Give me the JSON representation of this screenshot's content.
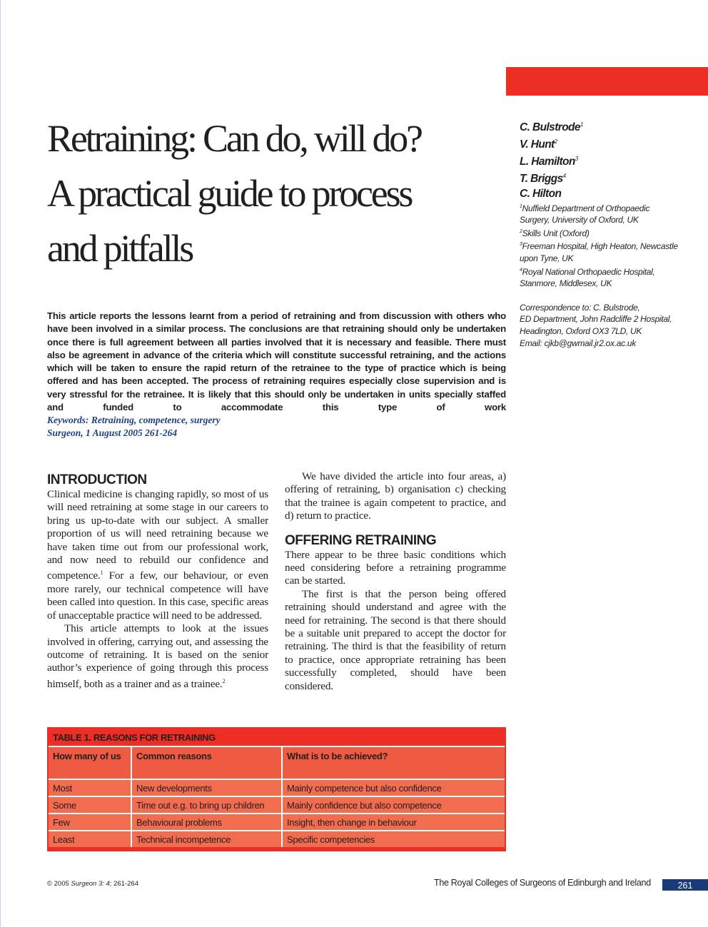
{
  "article": {
    "title_lines": [
      "Retraining: Can do, will do?",
      "A practical guide to process",
      "and pitfalls"
    ],
    "authors": [
      {
        "name": "C. Bulstrode",
        "sup": "1"
      },
      {
        "name": "V. Hunt",
        "sup": "2"
      },
      {
        "name": "L. Hamilton",
        "sup": "3"
      },
      {
        "name": "T. Briggs",
        "sup": "4"
      },
      {
        "name": "C. Hilton",
        "sup": ""
      }
    ],
    "affiliations": [
      {
        "sup": "1",
        "lines": [
          "Nuffield Department of Orthopaedic",
          "Surgery, University of Oxford, UK"
        ]
      },
      {
        "sup": "2",
        "lines": [
          "Skills Unit (Oxford)"
        ]
      },
      {
        "sup": "3",
        "lines": [
          "Freeman Hospital, High Heaton, Newcastle",
          "upon Tyne, UK"
        ]
      },
      {
        "sup": "4",
        "lines": [
          "Royal National Orthopaedic Hospital,",
          "Stanmore, Middlesex, UK"
        ]
      }
    ],
    "correspondence": [
      "Correspondence to: C. Bulstrode,",
      "ED Department, John Radcliffe 2 Hospital,",
      "Headington, Oxford OX3 7LD, UK",
      "Email: cjkb@gwmail.jr2.ox.ac.uk"
    ],
    "abstract": "This article reports the lessons learnt from a period of retraining and from discussion with others who have been involved in a similar process. The conclusions are that retraining should only be undertaken once there is full agreement between all parties involved that it is necessary and feasible. There must also be agreement in advance of the criteria which will constitute successful retraining, and the actions which will be taken to ensure the rapid return of the retrainee to the type of practice which is being offered and has been accepted. The process of retraining requires especially close supervision and is very stressful for the retrainee. It is likely that this should only be undertaken in units specially staffed and funded to accommodate this type of work",
    "keywords": "Keywords: Retraining, competence, surgery",
    "citation": "Surgeon, 1 August 2005 261-264"
  },
  "body": {
    "introduction": {
      "heading": "INTRODUCTION",
      "p1_a": "Clinical medicine is changing rapidly, so most of us will need retraining at some stage in our careers to bring us up-to-date with our subject. A smaller proportion of us will need retraining because we have taken time out from our professional work, and now need to rebuild our confidence and competence.",
      "p1_sup": "1",
      "p1_b": " For a few, our behaviour, or even more rarely, our technical competence will have been called into question. In this case, specific areas of unacceptable practice will need to be addressed.",
      "p2": "This article attempts to look at the issues involved in offering, carrying out, and assessing the outcome of retraining. It is based on the senior author’s experience of going through this process himself, both as a trainer and as a trainee.",
      "p2_sup": "2"
    },
    "overview": "We have divided the article into four areas, a) offering of retraining, b) organisation c) checking that the trainee is again competent to practice, and d) return to practice.",
    "offering": {
      "heading": "OFFERING RETRAINING",
      "p1": "There appear to be three basic conditions which need considering before a retraining programme can be started.",
      "p2": "The first is that the person being offered retraining should understand and agree with the need for retraining. The second is that there should be a suitable unit prepared to accept the doctor for retraining. The third is that the feasibility of return to practice, once appropriate retraining has been successfully completed, should have been considered."
    }
  },
  "table": {
    "caption": "TABLE 1. REASONS FOR RETRAINING",
    "headers": [
      "How many of us",
      "Common reasons",
      "What is to be achieved?"
    ],
    "rows": [
      [
        "Most",
        "New developments",
        "Mainly competence but also confidence"
      ],
      [
        "Some",
        "Time out e.g. to bring up children",
        "Mainly confidence but also competence"
      ],
      [
        "Few",
        "Behavioural problems",
        "Insight, then change in behaviour"
      ],
      [
        "Least",
        "Technical incompetence",
        "Specific competencies"
      ]
    ]
  },
  "footer": {
    "copyright": "© 2005",
    "journal": "Surgeon 3: 4;",
    "pages": " 261-264",
    "publisher": "The Royal Colleges of Surgeons of Edinburgh and Ireland",
    "page_number": "261"
  },
  "colors": {
    "accent_red": "#ee2e24",
    "table_header": "#ef5a42",
    "table_cell": "#f26c50",
    "keyword_blue": "#1f3f7e",
    "page_badge": "#1b3a78"
  }
}
